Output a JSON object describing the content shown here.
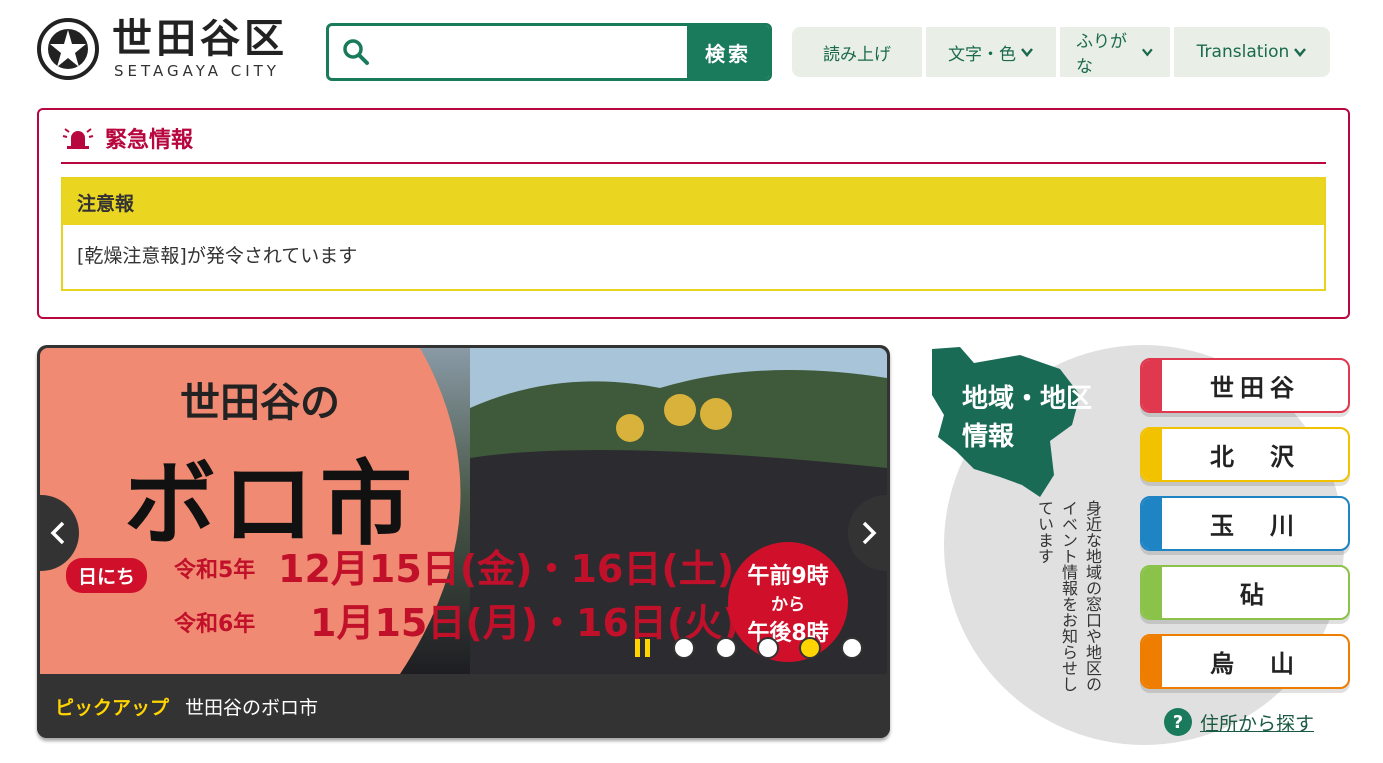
{
  "header": {
    "logo_jp": "世田谷区",
    "logo_en": "SETAGAYA CITY",
    "search_placeholder": "",
    "search_button": "検索",
    "tools": [
      {
        "label": "読み上げ"
      },
      {
        "label": "文字・色"
      },
      {
        "label": "ふりがな"
      },
      {
        "label": "Translation"
      }
    ]
  },
  "emergency": {
    "title": "緊急情報",
    "alert_level": "注意報",
    "alert_text": "[乾燥注意報]が発令されています"
  },
  "carousel": {
    "slide": {
      "headline_top": "世田谷の",
      "headline_main": "ボロ市",
      "tag": "日にち",
      "date_line1_era": "令和5年",
      "date_line1": "12月15日(金)・16日(土)",
      "date_line2_era": "令和6年",
      "date_line2": "1月15日(月)・16日(火)",
      "time_top": "午前9時",
      "time_mid": "から",
      "time_bottom": "午後8時"
    },
    "caption_tag": "ピックアップ",
    "caption_title": "世田谷のボロ市",
    "dot_count": 5,
    "active_dot": 3
  },
  "region": {
    "title_line1": "地域・地区",
    "title_line2": "情報",
    "description": "身近な地域の窓口や地区のイベント情報をお知らせしています",
    "buttons": [
      {
        "label": "世田谷",
        "color": "#e0394f"
      },
      {
        "label": "北　沢",
        "color": "#f2c200"
      },
      {
        "label": "玉　川",
        "color": "#1f84c4"
      },
      {
        "label": "砧",
        "color": "#8bc34a"
      },
      {
        "label": "烏　山",
        "color": "#ef7d00"
      }
    ],
    "address_link": "住所から探す"
  },
  "colors": {
    "brand_green": "#1a7a5c",
    "emergency_red": "#b8073f",
    "alert_yellow": "#ead620"
  }
}
